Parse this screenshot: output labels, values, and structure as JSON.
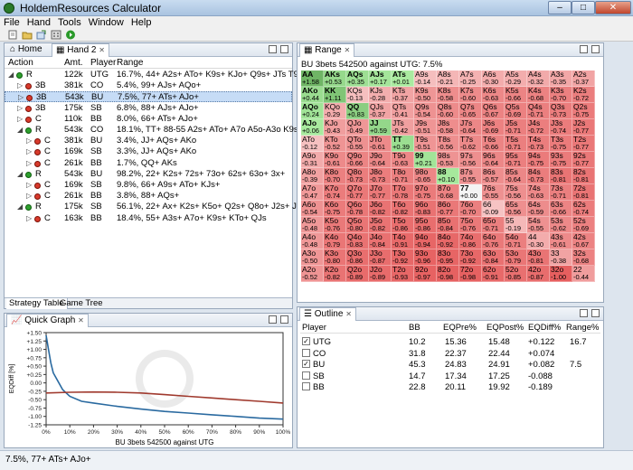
{
  "window": {
    "title": "HoldemResources Calculator",
    "min_label": "–",
    "max_label": "□",
    "close_label": "✕"
  },
  "menu": [
    "File",
    "Hand",
    "Tools",
    "Window",
    "Help"
  ],
  "toolbar": {
    "icons": [
      "new-document-icon",
      "open-folder-icon",
      "export-icon",
      "calculate-icon",
      "run-icon"
    ]
  },
  "left_panel": {
    "tabs": [
      {
        "label": "Home"
      },
      {
        "label": "Hand 2",
        "close": "✕"
      }
    ],
    "columns": [
      "Action",
      "Amt.",
      "Player",
      "Range"
    ],
    "rows": [
      {
        "depth": 0,
        "status": "green",
        "action": "R",
        "amt": "122k",
        "player": "UTG",
        "range": "16.7%, 44+ A2s+ ATo+ K9s+ KJo+ Q9s+ JTs T9s",
        "expanded": true
      },
      {
        "depth": 1,
        "status": "red",
        "action": "3B",
        "amt": "381k",
        "player": "CO",
        "range": "5.4%, 99+ AJs+ AQo+",
        "expanded": false
      },
      {
        "depth": 1,
        "status": "red",
        "action": "3B",
        "amt": "543k",
        "player": "BU",
        "range": "7.5%, 77+ ATs+ AJo+",
        "expanded": false,
        "selected": true
      },
      {
        "depth": 1,
        "status": "red",
        "action": "3B",
        "amt": "175k",
        "player": "SB",
        "range": "6.8%, 88+ AJs+ AJo+",
        "expanded": false
      },
      {
        "depth": 1,
        "status": "red",
        "action": "C",
        "amt": "110k",
        "player": "BB",
        "range": "8.0%, 66+ ATs+ AJo+",
        "expanded": false
      },
      {
        "depth": 1,
        "status": "green",
        "action": "R",
        "amt": "543k",
        "player": "CO",
        "range": "18.1%, TT+ 88-55 A2s+ ATo+ A7o A5o-A3o K9s+ KJo+ QJs",
        "expanded": true
      },
      {
        "depth": 2,
        "status": "red",
        "action": "C",
        "amt": "381k",
        "player": "BU",
        "range": "3.4%, JJ+ AQs+ AKo",
        "expanded": false
      },
      {
        "depth": 2,
        "status": "red",
        "action": "C",
        "amt": "169k",
        "player": "SB",
        "range": "3.3%, JJ+ AQs+ AKo",
        "expanded": false
      },
      {
        "depth": 2,
        "status": "red",
        "action": "C",
        "amt": "261k",
        "player": "BB",
        "range": "1.7%, QQ+ AKs",
        "expanded": false
      },
      {
        "depth": 1,
        "status": "green",
        "action": "R",
        "amt": "543k",
        "player": "BU",
        "range": "98.2%, 22+ K2s+ 72s+ 73o+ 62s+ 63o+ 3x+",
        "expanded": true
      },
      {
        "depth": 2,
        "status": "red",
        "action": "C",
        "amt": "169k",
        "player": "SB",
        "range": "9.8%, 66+ A9s+ ATo+ KJs+",
        "expanded": false
      },
      {
        "depth": 2,
        "status": "red",
        "action": "C",
        "amt": "261k",
        "player": "BB",
        "range": "3.8%, 88+ AQs+",
        "expanded": false
      },
      {
        "depth": 1,
        "status": "green",
        "action": "R",
        "amt": "175k",
        "player": "SB",
        "range": "56.1%, 22+ Ax+ K2s+ K5o+ Q2s+ Q8o+ J2s+ J8o+ T3s+ T7o+ 9",
        "expanded": true
      },
      {
        "depth": 2,
        "status": "red",
        "action": "C",
        "amt": "163k",
        "player": "BB",
        "range": "18.4%, 55+ A3s+ A7o+ K9s+ KTo+ QJs",
        "expanded": false
      }
    ],
    "bottom_tabs": [
      "Strategy Table",
      "Game Tree"
    ]
  },
  "quick_graph": {
    "tab": "Quick Graph",
    "close": "✕",
    "caption": "BU 3bets 542500 against UTG"
  },
  "chart_data": {
    "type": "line",
    "title": "",
    "xlabel": "BU 3bets 542500 against UTG",
    "ylabel": "EQDiff [%]",
    "xlim": [
      0,
      100
    ],
    "ylim": [
      -1.25,
      1.5
    ],
    "x_ticks": [
      "0%",
      "10%",
      "20%",
      "30%",
      "40%",
      "50%",
      "60%",
      "70%",
      "80%",
      "90%",
      "100%"
    ],
    "y_ticks": [
      "+1.50",
      "+1.25",
      "+1.00",
      "+0.75",
      "+0.50",
      "+0.25",
      "0.00",
      "-0.25",
      "-0.50",
      "-0.75",
      "-1.00",
      "-1.25"
    ],
    "series": [
      {
        "color": "#2a6aa0",
        "x": [
          0,
          1,
          2,
          3,
          5,
          7,
          10,
          15,
          20,
          30,
          40,
          50,
          60,
          70,
          80,
          90,
          100
        ],
        "y": [
          1.42,
          1.0,
          0.6,
          0.3,
          0.05,
          -0.2,
          -0.4,
          -0.55,
          -0.6,
          -0.7,
          -0.78,
          -0.85,
          -0.9,
          -0.95,
          -1.0,
          -1.05,
          -1.08
        ]
      },
      {
        "color": "#a03a2e",
        "x": [
          0,
          10,
          20,
          30,
          40,
          50,
          60,
          70,
          80,
          90,
          100
        ],
        "y": [
          -0.3,
          -0.28,
          -0.27,
          -0.28,
          -0.3,
          -0.35,
          -0.4,
          -0.45,
          -0.5,
          -0.55,
          -0.6
        ]
      }
    ]
  },
  "range_panel": {
    "tab": "Range",
    "close": "✕",
    "header": "BU 3bets 542500 against UTG: 7.5%",
    "grid": [
      [
        [
          "AA",
          "+1.58"
        ],
        [
          "AKs",
          "+0.53"
        ],
        [
          "AQs",
          "+0.35"
        ],
        [
          "AJs",
          "+0.17"
        ],
        [
          "ATs",
          "+0.01"
        ],
        [
          "A9s",
          "-0.14"
        ],
        [
          "A8s",
          "-0.21"
        ],
        [
          "A7s",
          "-0.25"
        ],
        [
          "A6s",
          "-0.30"
        ],
        [
          "A5s",
          "-0.29"
        ],
        [
          "A4s",
          "-0.32"
        ],
        [
          "A3s",
          "-0.35"
        ],
        [
          "A2s",
          "-0.37"
        ]
      ],
      [
        [
          "AKo",
          "+0.44"
        ],
        [
          "KK",
          "+1.11"
        ],
        [
          "KQs",
          "-0.13"
        ],
        [
          "KJs",
          "-0.28"
        ],
        [
          "KTs",
          "-0.37"
        ],
        [
          "K9s",
          "-0.50"
        ],
        [
          "K8s",
          "-0.58"
        ],
        [
          "K7s",
          "-0.60"
        ],
        [
          "K6s",
          "-0.63"
        ],
        [
          "K5s",
          "-0.66"
        ],
        [
          "K4s",
          "-0.68"
        ],
        [
          "K3s",
          "-0.70"
        ],
        [
          "K2s",
          "-0.72"
        ]
      ],
      [
        [
          "AQo",
          "+0.24"
        ],
        [
          "KQo",
          "-0.29"
        ],
        [
          "QQ",
          "+0.83"
        ],
        [
          "QJs",
          "-0.37"
        ],
        [
          "QTs",
          "-0.41"
        ],
        [
          "Q9s",
          "-0.54"
        ],
        [
          "Q8s",
          "-0.60"
        ],
        [
          "Q7s",
          "-0.65"
        ],
        [
          "Q6s",
          "-0.67"
        ],
        [
          "Q5s",
          "-0.69"
        ],
        [
          "Q4s",
          "-0.71"
        ],
        [
          "Q3s",
          "-0.73"
        ],
        [
          "Q2s",
          "-0.75"
        ]
      ],
      [
        [
          "AJo",
          "+0.06"
        ],
        [
          "KJo",
          "-0.43"
        ],
        [
          "QJo",
          "-0.49"
        ],
        [
          "JJ",
          "+0.59"
        ],
        [
          "JTs",
          "-0.42"
        ],
        [
          "J9s",
          "-0.51"
        ],
        [
          "J8s",
          "-0.58"
        ],
        [
          "J7s",
          "-0.64"
        ],
        [
          "J6s",
          "-0.69"
        ],
        [
          "J5s",
          "-0.71"
        ],
        [
          "J4s",
          "-0.72"
        ],
        [
          "J3s",
          "-0.74"
        ],
        [
          "J2s",
          "-0.77"
        ]
      ],
      [
        [
          "ATo",
          "-0.12"
        ],
        [
          "KTo",
          "-0.52"
        ],
        [
          "QTo",
          "-0.55"
        ],
        [
          "JTo",
          "-0.61"
        ],
        [
          "TT",
          "+0.39"
        ],
        [
          "T9s",
          "-0.51"
        ],
        [
          "T8s",
          "-0.56"
        ],
        [
          "T7s",
          "-0.62"
        ],
        [
          "T6s",
          "-0.66"
        ],
        [
          "T5s",
          "-0.71"
        ],
        [
          "T4s",
          "-0.73"
        ],
        [
          "T3s",
          "-0.75"
        ],
        [
          "T2s",
          "-0.77"
        ]
      ],
      [
        [
          "A9o",
          "-0.31"
        ],
        [
          "K9o",
          "-0.61"
        ],
        [
          "Q9o",
          "-0.66"
        ],
        [
          "J9o",
          "-0.64"
        ],
        [
          "T9o",
          "-0.63"
        ],
        [
          "99",
          "+0.21"
        ],
        [
          "98s",
          "-0.53"
        ],
        [
          "97s",
          "-0.56"
        ],
        [
          "96s",
          "-0.64"
        ],
        [
          "95s",
          "-0.71"
        ],
        [
          "94s",
          "-0.75"
        ],
        [
          "93s",
          "-0.75"
        ],
        [
          "92s",
          "-0.77"
        ]
      ],
      [
        [
          "A8o",
          "-0.39"
        ],
        [
          "K8o",
          "-0.70"
        ],
        [
          "Q8o",
          "-0.73"
        ],
        [
          "J8o",
          "-0.73"
        ],
        [
          "T8o",
          "-0.71"
        ],
        [
          "98o",
          "-0.65"
        ],
        [
          "88",
          "+0.10"
        ],
        [
          "87s",
          "-0.55"
        ],
        [
          "86s",
          "-0.57"
        ],
        [
          "85s",
          "-0.64"
        ],
        [
          "84s",
          "-0.73"
        ],
        [
          "83s",
          "-0.81"
        ],
        [
          "82s",
          "-0.81"
        ]
      ],
      [
        [
          "A7o",
          "-0.47"
        ],
        [
          "K7o",
          "-0.74"
        ],
        [
          "Q7o",
          "-0.77"
        ],
        [
          "J7o",
          "-0.77"
        ],
        [
          "T7o",
          "-0.78"
        ],
        [
          "97o",
          "-0.75"
        ],
        [
          "87o",
          "-0.68"
        ],
        [
          "77",
          "+0.00"
        ],
        [
          "76s",
          "-0.55"
        ],
        [
          "75s",
          "-0.56"
        ],
        [
          "74s",
          "-0.63"
        ],
        [
          "73s",
          "-0.71"
        ],
        [
          "72s",
          "-0.81"
        ]
      ],
      [
        [
          "A6o",
          "-0.54"
        ],
        [
          "K6o",
          "-0.75"
        ],
        [
          "Q6o",
          "-0.78"
        ],
        [
          "J6o",
          "-0.82"
        ],
        [
          "T6o",
          "-0.82"
        ],
        [
          "96o",
          "-0.83"
        ],
        [
          "86o",
          "-0.77"
        ],
        [
          "76o",
          "-0.70"
        ],
        [
          "66",
          "-0.09"
        ],
        [
          "65s",
          "-0.56"
        ],
        [
          "64s",
          "-0.59"
        ],
        [
          "63s",
          "-0.66"
        ],
        [
          "62s",
          "-0.74"
        ]
      ],
      [
        [
          "A5o",
          "-0.48"
        ],
        [
          "K5o",
          "-0.76"
        ],
        [
          "Q5o",
          "-0.80"
        ],
        [
          "J5o",
          "-0.82"
        ],
        [
          "T5o",
          "-0.86"
        ],
        [
          "95o",
          "-0.86"
        ],
        [
          "85o",
          "-0.84"
        ],
        [
          "75o",
          "-0.76"
        ],
        [
          "65o",
          "-0.71"
        ],
        [
          "55",
          "-0.19"
        ],
        [
          "54s",
          "-0.55"
        ],
        [
          "53s",
          "-0.62"
        ],
        [
          "52s",
          "-0.69"
        ]
      ],
      [
        [
          "A4o",
          "-0.48"
        ],
        [
          "K4o",
          "-0.79"
        ],
        [
          "Q4o",
          "-0.83"
        ],
        [
          "J4o",
          "-0.84"
        ],
        [
          "T4o",
          "-0.91"
        ],
        [
          "94o",
          "-0.94"
        ],
        [
          "84o",
          "-0.92"
        ],
        [
          "74o",
          "-0.86"
        ],
        [
          "64o",
          "-0.76"
        ],
        [
          "54o",
          "-0.71"
        ],
        [
          "44",
          "-0.30"
        ],
        [
          "43s",
          "-0.61"
        ],
        [
          "42s",
          "-0.67"
        ]
      ],
      [
        [
          "A3o",
          "-0.50"
        ],
        [
          "K3o",
          "-0.80"
        ],
        [
          "Q3o",
          "-0.86"
        ],
        [
          "J3o",
          "-0.87"
        ],
        [
          "T3o",
          "-0.92"
        ],
        [
          "93o",
          "-0.96"
        ],
        [
          "83o",
          "-0.95"
        ],
        [
          "73o",
          "-0.92"
        ],
        [
          "63o",
          "-0.84"
        ],
        [
          "53o",
          "-0.79"
        ],
        [
          "43o",
          "-0.81"
        ],
        [
          "33",
          "-0.38"
        ],
        [
          "32s",
          "-0.68"
        ]
      ],
      [
        [
          "A2o",
          "-0.52"
        ],
        [
          "K2o",
          "-0.82"
        ],
        [
          "Q2o",
          "-0.89"
        ],
        [
          "J2o",
          "-0.89"
        ],
        [
          "T2o",
          "-0.93"
        ],
        [
          "92o",
          "-0.97"
        ],
        [
          "82o",
          "-0.98"
        ],
        [
          "72o",
          "-0.98"
        ],
        [
          "62o",
          "-0.91"
        ],
        [
          "52o",
          "-0.85"
        ],
        [
          "42o",
          "-0.87"
        ],
        [
          "32o",
          "-1.00"
        ],
        [
          "22",
          "-0.44"
        ]
      ]
    ],
    "selected": [
      "AA",
      "AKs",
      "AQs",
      "AJs",
      "ATs",
      "AKo",
      "KK",
      "AQo",
      "QQ",
      "AJo",
      "JJ",
      "TT",
      "99",
      "88",
      "77"
    ]
  },
  "outline": {
    "tab": "Outline",
    "close": "✕",
    "columns": [
      "Player",
      "BB",
      "EQPre%",
      "EQPost%",
      "EQDiff%",
      "Range%"
    ],
    "rows": [
      {
        "checked": true,
        "player": "UTG",
        "bb": "10.2",
        "pre": "15.36",
        "post": "15.48",
        "diff": "+0.122",
        "range": "16.7"
      },
      {
        "checked": false,
        "player": "CO",
        "bb": "31.8",
        "pre": "22.37",
        "post": "22.44",
        "diff": "+0.074",
        "range": ""
      },
      {
        "checked": true,
        "player": "BU",
        "bb": "45.3",
        "pre": "24.83",
        "post": "24.91",
        "diff": "+0.082",
        "range": "7.5"
      },
      {
        "checked": false,
        "player": "SB",
        "bb": "14.7",
        "pre": "17.34",
        "post": "17.25",
        "diff": "-0.088",
        "range": ""
      },
      {
        "checked": false,
        "player": "BB",
        "bb": "22.8",
        "pre": "20.11",
        "post": "19.92",
        "diff": "-0.189",
        "range": ""
      }
    ]
  },
  "status": {
    "text": "7.5%, 77+ ATs+ AJo+"
  }
}
